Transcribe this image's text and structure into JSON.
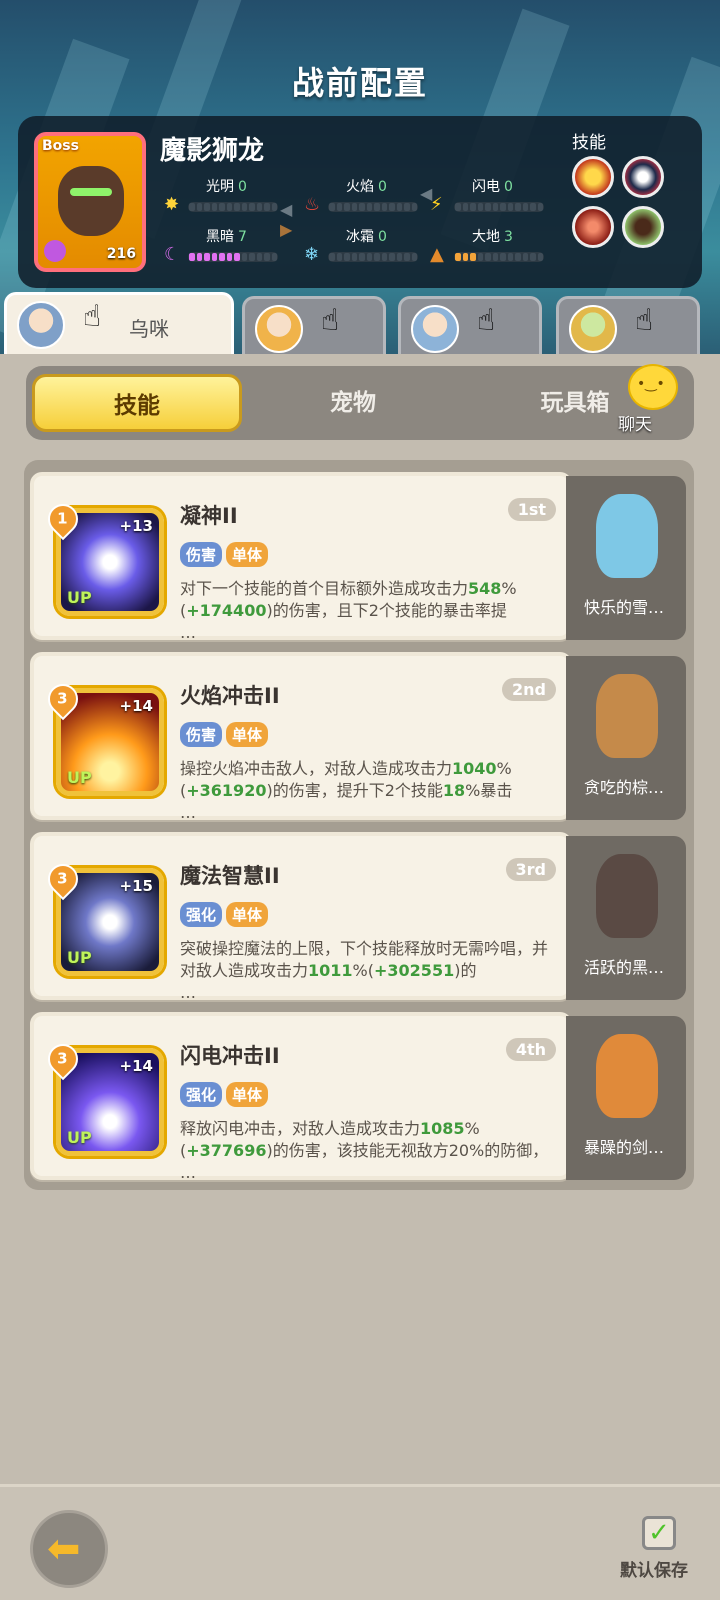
{
  "header": {
    "title": "战前配置"
  },
  "boss": {
    "tag": "Boss",
    "name": "魔影狮龙",
    "level": "216",
    "skills_label": "技能",
    "elements": [
      {
        "name": "光明",
        "value": "0",
        "icon": "sun-icon"
      },
      {
        "name": "火焰",
        "value": "0",
        "icon": "flame-icon"
      },
      {
        "name": "闪电",
        "value": "0",
        "icon": "lightning-icon"
      },
      {
        "name": "黑暗",
        "value": "7",
        "icon": "moon-icon"
      },
      {
        "name": "冰霜",
        "value": "0",
        "icon": "snowflake-icon"
      },
      {
        "name": "大地",
        "value": "3",
        "icon": "earth-icon"
      }
    ]
  },
  "hero_tabs": [
    {
      "name": "乌咪",
      "active": true
    },
    {
      "name": "",
      "active": false
    },
    {
      "name": "",
      "active": false
    },
    {
      "name": "",
      "active": false
    }
  ],
  "segments": {
    "skill": "技能",
    "pet": "宠物",
    "toy": "玩具箱"
  },
  "chat": {
    "label": "聊天"
  },
  "skills": [
    {
      "badge": "1",
      "plus": "+13",
      "up": "UP",
      "name": "凝神II",
      "order": "1st",
      "tags": [
        "伤害",
        "单体"
      ],
      "desc_parts": [
        "对下一个技能的首个目标额外造成攻击力",
        "548",
        "%(",
        "+174400",
        ")的伤害，且下2个技能的暴击率提",
        "…"
      ],
      "pet_name": "快乐的雪…"
    },
    {
      "badge": "3",
      "plus": "+14",
      "up": "UP",
      "name": "火焰冲击II",
      "order": "2nd",
      "tags": [
        "伤害",
        "单体"
      ],
      "desc_parts": [
        "操控火焰冲击敌人，对敌人造成攻击力",
        "1040",
        "%(",
        "+361920",
        ")的伤害，提升下2个技能",
        "18",
        "%暴击",
        "…"
      ],
      "pet_name": "贪吃的棕…"
    },
    {
      "badge": "3",
      "plus": "+15",
      "up": "UP",
      "name": "魔法智慧II",
      "order": "3rd",
      "tags": [
        "强化",
        "单体"
      ],
      "desc_parts": [
        "突破操控魔法的上限，下个技能释放时无需吟唱，并对敌人造成攻击力",
        "1011",
        "%(",
        "+302551",
        ")的",
        "…"
      ],
      "pet_name": "活跃的黑…"
    },
    {
      "badge": "3",
      "plus": "+14",
      "up": "UP",
      "name": "闪电冲击II",
      "order": "4th",
      "tags": [
        "强化",
        "单体"
      ],
      "desc_parts": [
        "释放闪电冲击，对敌人造成攻击力",
        "1085",
        "%(",
        "+377696",
        ")的伤害，该技能无视敌方20%的防御，",
        "…"
      ],
      "pet_name": "暴躁的剑…"
    }
  ],
  "bottom": {
    "save_label": "默认保存",
    "back_icon": "back-arrow-icon"
  },
  "colors": {
    "accent_yellow": "#f6cf3a",
    "green_value": "#3f9a3c",
    "tag_blue": "#6a8fd2",
    "tag_orange": "#f0a43a"
  }
}
